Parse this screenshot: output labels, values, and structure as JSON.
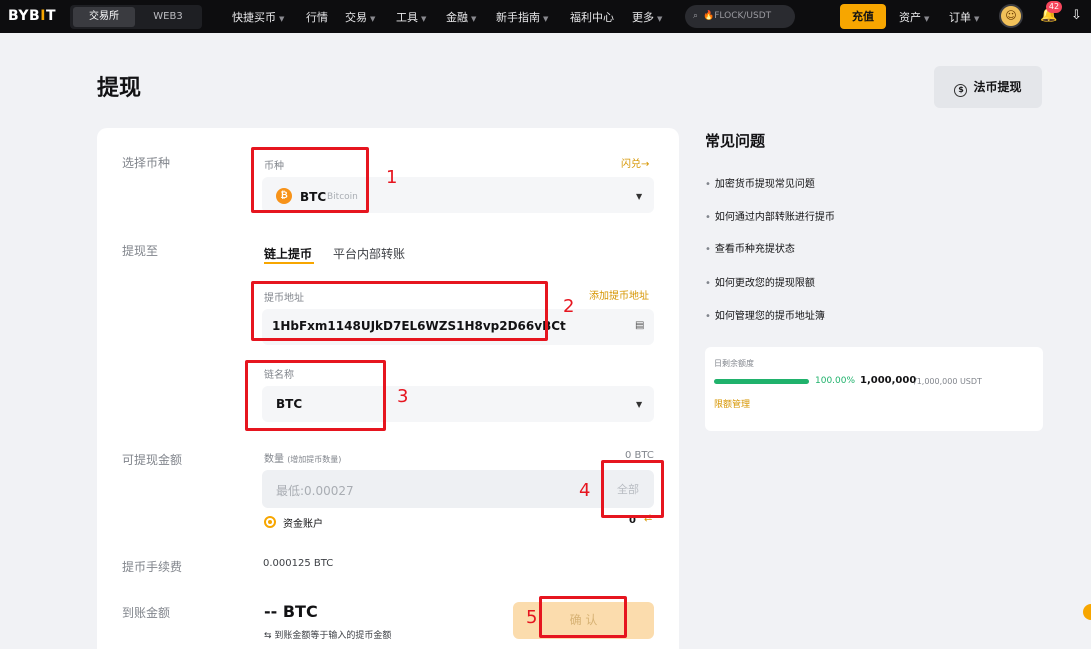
{
  "nav": {
    "logo": "BYB",
    "logo_accent": "I",
    "logo_end": "T",
    "segments": [
      "交易所",
      "WEB3"
    ],
    "items": [
      "快捷买币",
      "行情",
      "交易",
      "工具",
      "金融",
      "新手指南",
      "福利中心",
      "更多"
    ],
    "search_placeholder": "🔥FLOCK/USDT",
    "deposit_label": "充值",
    "assets_label": "资产",
    "orders_label": "订单",
    "notification_count": "42"
  },
  "page": {
    "title": "提现",
    "fiat_withdraw_label": "法币提现"
  },
  "form": {
    "select_coin_label": "选择币种",
    "coin_field_label": "币种",
    "coin_symbol": "BTC",
    "coin_name": "Bitcoin",
    "flash_exchange_link": "闪兑→",
    "withdraw_to_label": "提现至",
    "tabs": [
      "链上提币",
      "平台内部转账"
    ],
    "address_field_label": "提币地址",
    "add_address_link": "添加提币地址",
    "address_value": "1HbFxm1148UJkD7EL6WZS1H8vp2D66vBCt",
    "chain_field_label": "链名称",
    "chain_value": "BTC",
    "available_label": "可提现金额",
    "quantity_label": "数量",
    "quantity_hint": "(增加提币数量)",
    "balance": "0 BTC",
    "amount_placeholder": "最低:0.00027",
    "all_label": "全部",
    "account_label": "资金账户",
    "account_balance": "0",
    "fee_label": "提币手续费",
    "fee_value": "0.000125 BTC",
    "receive_label": "到账金额",
    "receive_value": "-- BTC",
    "receive_note": "⇆ 到账金额等于输入的提币金额",
    "confirm_label": "确 认"
  },
  "faq": {
    "title": "常见问题",
    "items": [
      "加密货币提现常见问题",
      "如何通过内部转账进行提币",
      "查看币种充提状态",
      "如何更改您的提现限额",
      "如何管理您的提币地址簿"
    ]
  },
  "limit": {
    "label": "日剩余额度",
    "percent_text": "100.00%",
    "progress": 1.0,
    "amount": "1,000,000",
    "total": "/1,000,000 USDT",
    "manage_link": "限额管理"
  },
  "annotations": [
    "1",
    "2",
    "3",
    "4",
    "5"
  ],
  "colors": {
    "accent": "#f7a600",
    "annotation": "#e6151f",
    "progress": "#20b26c"
  }
}
